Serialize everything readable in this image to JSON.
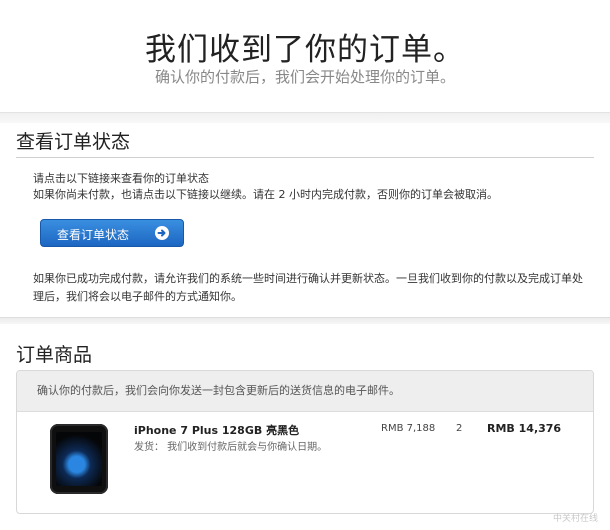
{
  "hero": {
    "title": "我们收到了你的订单。",
    "subtitle": "确认你的付款后，我们会开始处理你的订单。"
  },
  "status_section": {
    "title": "查看订单状态",
    "line1": "请点击以下链接来查看你的订单状态",
    "line2": "如果你尚未付款，也请点击以下链接以继续。请在 2 小时内完成付款，否则你的订单会被取消。",
    "button_label": "查看订单状态",
    "button_icon": "arrow-right-circle-icon",
    "note": "如果你已成功完成付款，请允许我们的系统一些时间进行确认并更新状态。一旦我们收到你的付款以及完成订单处理后，我们将会以电子邮件的方式通知你。"
  },
  "items_section": {
    "title": "订单商品",
    "notice": "确认你的付款后，我们会向你发送一封包含更新后的送货信息的电子邮件。",
    "items": [
      {
        "name": "iPhone 7 Plus 128GB 亮黑色",
        "shipping": "发货： 我们收到付款后就会与你确认日期。",
        "unit_price": "RMB 7,188",
        "quantity": "2",
        "total": "RMB 14,376"
      }
    ]
  },
  "watermark": "中关村在线"
}
